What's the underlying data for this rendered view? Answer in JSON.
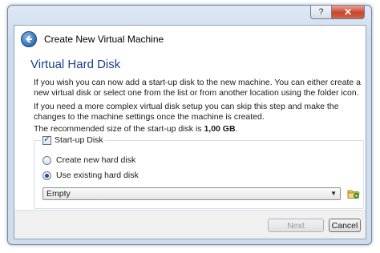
{
  "window": {
    "help_label": "?",
    "close_label": "✕"
  },
  "header": {
    "title": "Create New Virtual Machine"
  },
  "page": {
    "title": "Virtual Hard Disk",
    "paragraph1": "If you wish you can now add a start-up disk to the new machine. You can either create a new virtual disk or select one from the list or from another location using the folder icon.",
    "paragraph2": "If you need a more complex virtual disk setup you can skip this step and make the changes to the machine settings once the machine is created.",
    "recommended_prefix": "The recommended size of the start-up disk is ",
    "recommended_size": "1,00 GB",
    "recommended_suffix": "."
  },
  "startup_disk": {
    "label": "Start-up Disk",
    "checked": true,
    "options": [
      {
        "label": "Create new hard disk",
        "selected": false
      },
      {
        "label": "Use existing hard disk",
        "selected": true
      }
    ],
    "disk_select_value": "Empty"
  },
  "footer": {
    "next_label": "Next",
    "cancel_label": "Cancel"
  },
  "colors": {
    "title_blue": "#1e3f8a",
    "close_red": "#c8452c"
  }
}
